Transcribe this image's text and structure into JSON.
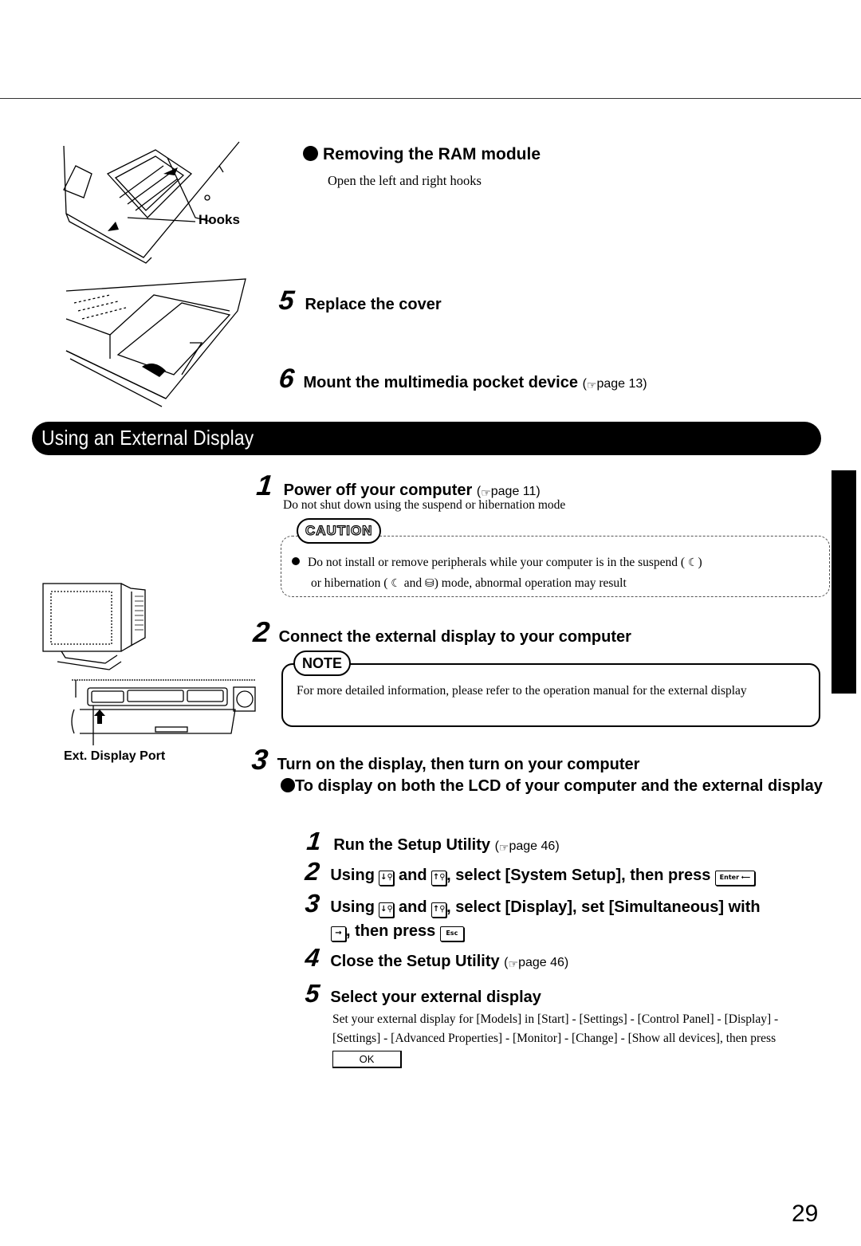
{
  "page": {
    "number": "29"
  },
  "ram_section": {
    "heading": "Removing the RAM module",
    "instruction": "Open the left and right hooks",
    "figure_label": "Hooks"
  },
  "steps_top": [
    {
      "num": "5",
      "title": "Replace the cover"
    },
    {
      "num": "6",
      "title": "Mount the multimedia pocket device",
      "page_ref": "page 13"
    }
  ],
  "section": {
    "title": "Using an External Display"
  },
  "steps": [
    {
      "num": "1",
      "title": "Power off your computer",
      "page_ref": "page 11",
      "body": "Do not shut down using the suspend or hibernation mode",
      "caution": {
        "label": "CAUTION",
        "line1": "Do not install or remove peripherals while your computer is in the suspend (",
        "line1_end": ")",
        "line2_a": "or hibernation (",
        "line2_and": "and",
        "line2_b": ") mode, abnormal operation may result",
        "icons": [
          "suspend-moon-icon",
          "hibernation-disk-icon"
        ]
      }
    },
    {
      "num": "2",
      "title": "Connect the external display to your computer",
      "note": {
        "label": "NOTE",
        "text": "For more detailed information, please refer to the operation manual for the external display"
      },
      "figure_label": "Ext. Display Port"
    },
    {
      "num": "3",
      "title": "Turn on the display, then turn on your computer",
      "sub_heading": "To display on both the LCD of your computer and the external display",
      "substeps": [
        {
          "num": "1",
          "text": "Run the Setup Utility",
          "page_ref": "page 46"
        },
        {
          "num": "2",
          "text_a": "Using",
          "text_and": "and",
          "text_b": ", select [System Setup], then press",
          "keys": [
            "down-arrow-key",
            "up-arrow-key",
            "enter-key"
          ]
        },
        {
          "num": "3",
          "text_a": "Using",
          "text_and": "and",
          "text_b": ", select [Display], set [Simultaneous] with",
          "text_c": ", then press",
          "keys": [
            "down-arrow-key",
            "up-arrow-key",
            "right-arrow-key",
            "esc-key"
          ]
        },
        {
          "num": "4",
          "text": "Close the Setup Utility",
          "page_ref": "page 46"
        },
        {
          "num": "5",
          "text": "Select your external display",
          "body": "Set your external display for  [Models] in [Start] - [Settings] - [Control Panel] - [Display] - [Settings] - [Advanced Properties] - [Monitor] - [Change] - [Show all devices], then press",
          "button": "OK"
        }
      ]
    }
  ],
  "keys": {
    "down": "↓⚲",
    "up": "↑⚲",
    "enter": "Enter ⟵",
    "esc": "Esc",
    "right": "→"
  },
  "glyphs": {
    "hand": "☞",
    "suspend": "☾",
    "disk": "⛁",
    "paren_open": "(",
    "paren_close": ")"
  }
}
